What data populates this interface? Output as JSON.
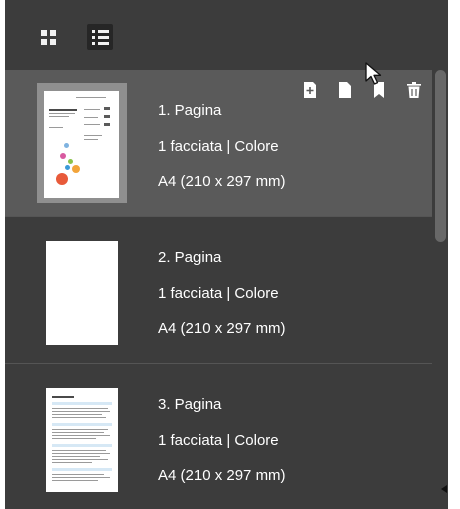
{
  "toolbar": {
    "grid_view": {
      "icon": "grid-icon"
    },
    "list_view": {
      "icon": "list-icon",
      "active": true
    }
  },
  "item_actions": [
    {
      "icon": "add-page-icon"
    },
    {
      "icon": "page-icon"
    },
    {
      "icon": "bookmark-icon"
    },
    {
      "icon": "trash-icon"
    }
  ],
  "pages": [
    {
      "title": "1. Pagina",
      "sides": "1 facciata | Colore",
      "size": "A4 (210 x 297 mm)",
      "selected": true
    },
    {
      "title": "2. Pagina",
      "sides": "1 facciata | Colore",
      "size": "A4 (210 x 297 mm)",
      "selected": false
    },
    {
      "title": "3. Pagina",
      "sides": "1 facciata | Colore",
      "size": "A4 (210 x 297 mm)",
      "selected": false
    }
  ],
  "colors": {
    "panel_bg": "#3c3c3c",
    "selected_bg": "#5a5a5a",
    "text": "#ffffff",
    "scroll_thumb": "#686868"
  }
}
